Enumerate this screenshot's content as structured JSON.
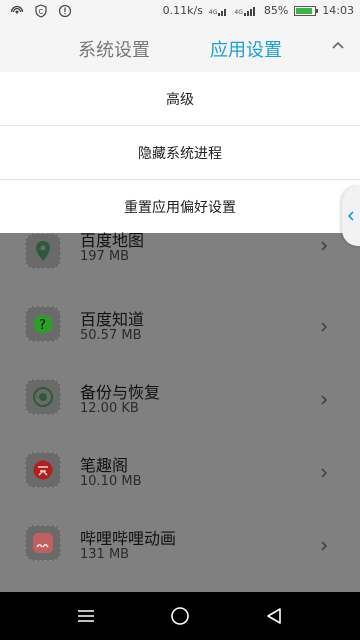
{
  "status": {
    "net_speed": "0.11k/s",
    "net_tags": [
      "4G",
      "4G"
    ],
    "battery": "85%",
    "battery_level": 0.85,
    "time": "14:03"
  },
  "tabs": {
    "system": "系统设置",
    "apps": "应用设置"
  },
  "menu": {
    "items": [
      "高级",
      "隐藏系统进程",
      "重置应用偏好设置"
    ]
  },
  "apps": [
    {
      "name": "百度地图",
      "size": "197 MB",
      "icon": "map-pin-icon",
      "color": "#2f5a3a"
    },
    {
      "name": "百度知道",
      "size": "50.57 MB",
      "icon": "question-icon",
      "color": "#2aa02a"
    },
    {
      "name": "备份与恢复",
      "size": "12.00 KB",
      "icon": "restore-icon",
      "color": "#2f5a3a"
    },
    {
      "name": "笔趣阁",
      "size": "10.10 MB",
      "icon": "book-icon",
      "color": "#b02020"
    },
    {
      "name": "哔哩哔哩动画",
      "size": "131 MB",
      "icon": "bilibili-icon",
      "color": "#c06060"
    }
  ],
  "colors": {
    "accent": "#1aa1d6",
    "overlay": "#808080"
  }
}
